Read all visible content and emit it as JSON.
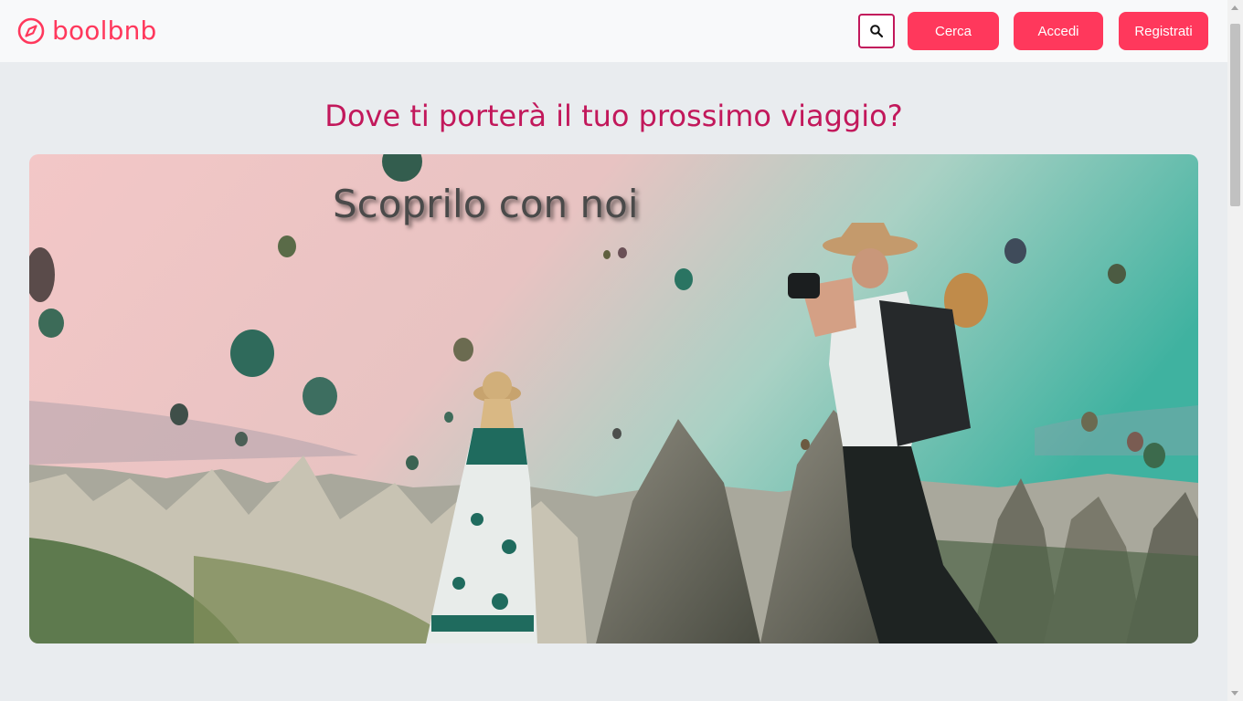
{
  "brand": {
    "name": "boolbnb",
    "icon": "compass-icon",
    "color": "#ff385c"
  },
  "nav": {
    "search_icon": "search-icon",
    "cerca_label": "Cerca",
    "accedi_label": "Accedi",
    "registrati_label": "Registrati"
  },
  "hero": {
    "headline": "Dove ti porterà il tuo prossimo viaggio?",
    "image_title": "Scoprilo con noi"
  },
  "colors": {
    "accent": "#ff385c",
    "headline": "#c2185b",
    "background": "#e9ecef"
  }
}
